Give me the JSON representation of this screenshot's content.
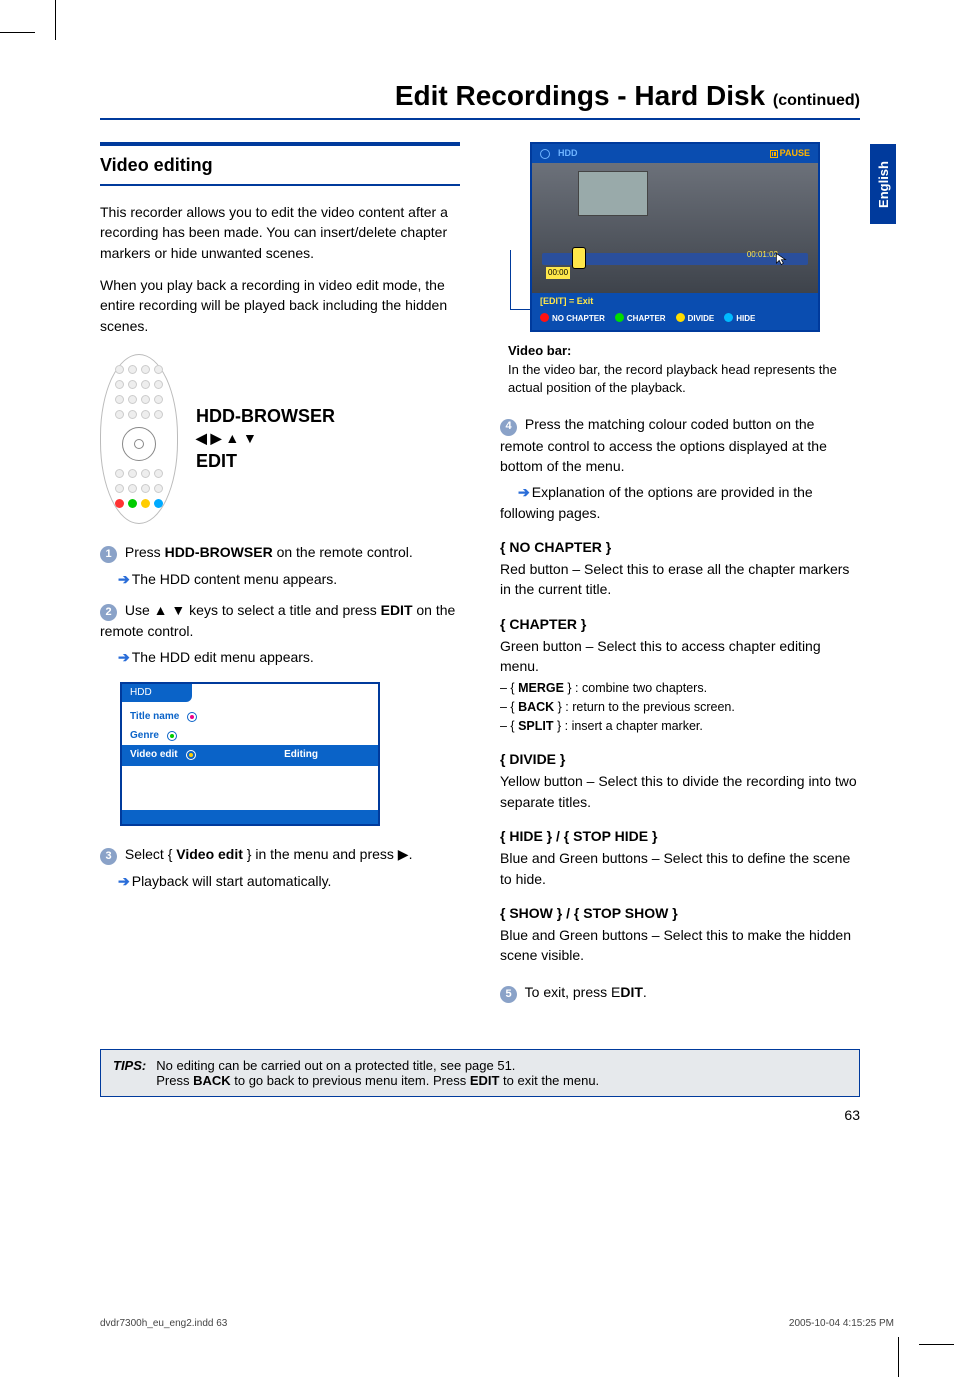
{
  "title_main": "Edit Recordings - Hard Disk ",
  "title_cont": "(continued)",
  "lang_tab": "English",
  "section_heading": "Video editing",
  "intro_p1": "This recorder allows you to edit the video content after a recording has been made. You can insert/delete chapter markers or hide unwanted scenes.",
  "intro_p2": "When you play back a recording in video edit mode, the entire recording will be played back including the hidden scenes.",
  "remote_labels": {
    "l1": "HDD-BROWSER",
    "l2": "◀ ▶ ▲ ▼",
    "l3": "EDIT"
  },
  "steps": {
    "s1a": "Press ",
    "s1b": "HDD-BROWSER",
    "s1c": " on the remote control.",
    "s1_sub": "The HDD content menu appears.",
    "s2a": "Use ▲ ▼ keys to select a title and press ",
    "s2b": "EDIT",
    "s2c": " on the remote control.",
    "s2_sub": "The HDD edit menu appears.",
    "s3a": "Select { ",
    "s3b": "Video edit",
    "s3c": " } in the menu and press ▶.",
    "s3_sub": "Playback will start automatically.",
    "s4": "Press the matching colour coded button on the remote control to access the options displayed at the bottom of the menu.",
    "s4_sub": "Explanation of the options are provided in the following pages.",
    "s5a": "To exit, press E",
    "s5b": "DIT",
    "s5c": "."
  },
  "hdd_menu": {
    "tab": "HDD",
    "row1": "Title name",
    "row2": "Genre",
    "row3": "Video edit",
    "pill": "Editing"
  },
  "video_bar": {
    "top_left": "HDD",
    "top_right": "PAUSE",
    "time1": "00:00",
    "time2": "00:01:02",
    "edit_line": "[EDIT] = Exit",
    "b1": "NO CHAPTER",
    "b2": "CHAPTER",
    "b3": "DIVIDE",
    "b4": "HIDE"
  },
  "vb_cap_title": "Video bar:",
  "vb_cap_body": "In the video bar, the record playback head represents the actual position of the playback.",
  "opts": {
    "nochap_h": "NO CHAPTER",
    "nochap_b": "Red button – Select this to erase all the chapter markers in the current title.",
    "chap_h": "CHAPTER",
    "chap_b": "Green button – Select this to access chapter editing menu.",
    "chap_l1a": "MERGE",
    "chap_l1b": " } : combine two chapters.",
    "chap_l2a": "BACK",
    "chap_l2b": " } : return to the previous screen.",
    "chap_l3a": "SPLIT",
    "chap_l3b": " } : insert a chapter marker.",
    "div_h": "DIVIDE",
    "div_b": "Yellow button – Select this to divide the recording into two separate titles.",
    "hide_h1": "HIDE",
    "hide_h2": "STOP HIDE",
    "hide_b": "Blue and Green buttons – Select this to define the scene to hide.",
    "show_h1": "SHOW",
    "show_h2": "STOP SHOW",
    "show_b": "Blue and Green buttons – Select this to make the hidden scene visible."
  },
  "tips_label": "TIPS:",
  "tips_l1a": "No editing can be carried out on a protected title, see page 51.",
  "tips_l2a": "Press ",
  "tips_l2b": "BACK",
  "tips_l2c": " to go back to previous menu item. Press ",
  "tips_l2d": "EDIT",
  "tips_l2e": " to exit the menu.",
  "page_number": "63",
  "footer_left": "dvdr7300h_eu_eng2.indd   63",
  "footer_right": "2005-10-04   4:15:25 PM"
}
